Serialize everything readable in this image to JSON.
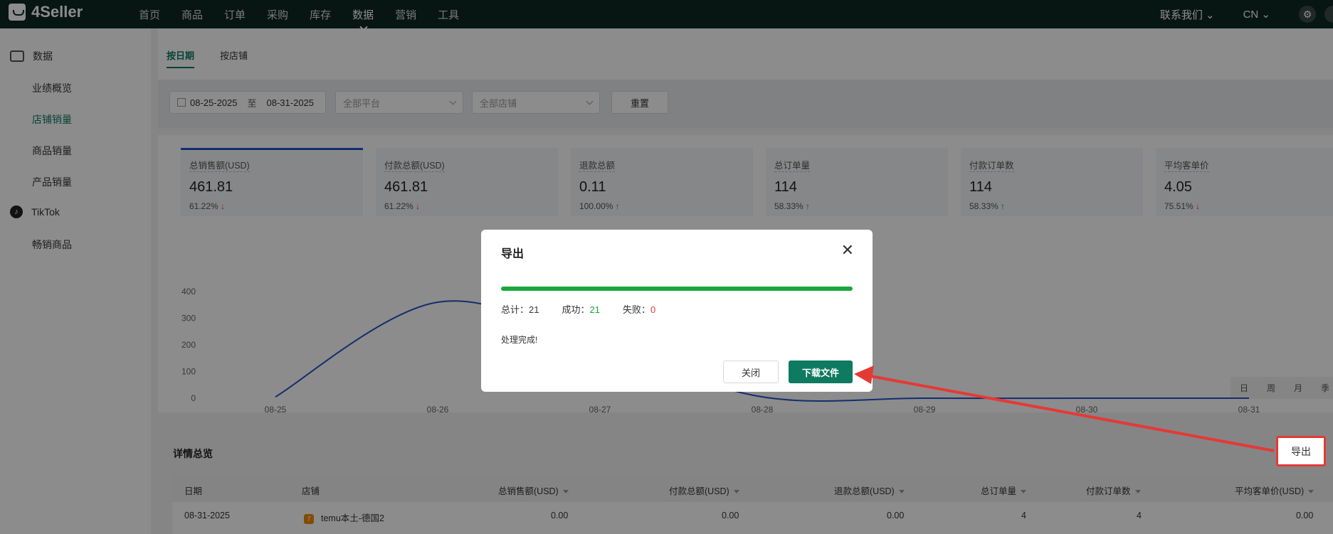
{
  "app": {
    "logo_text": "4Seller"
  },
  "nav": {
    "items": [
      "首页",
      "商品",
      "订单",
      "采购",
      "库存",
      "数据",
      "营销",
      "工具"
    ],
    "active": "数据"
  },
  "topbar": {
    "contact": "联系我们 ⌄",
    "lang": "CN ⌄"
  },
  "sidebar": {
    "group_data": "数据",
    "items": [
      "业绩概览",
      "店铺销量",
      "商品销量",
      "产品销量"
    ],
    "active": "店铺销量",
    "group_tiktok": "TikTok",
    "tiktok_items": [
      "畅销商品"
    ]
  },
  "tabs": [
    "按日期",
    "按店铺"
  ],
  "filters": {
    "date_from": "08-25-2025",
    "date_sep": "至",
    "date_to": "08-31-2025",
    "platform": "全部平台",
    "store": "全部店铺",
    "reset": "重置"
  },
  "kpis": [
    {
      "label": "总销售额(USD)",
      "value": "461.81",
      "change": "61.22%",
      "dir": "down"
    },
    {
      "label": "付款总额(USD)",
      "value": "461.81",
      "change": "61.22%",
      "dir": "down"
    },
    {
      "label": "退款总额",
      "value": "0.11",
      "change": "100.00%",
      "dir": "up"
    },
    {
      "label": "总订单量",
      "value": "114",
      "change": "58.33%",
      "dir": "up"
    },
    {
      "label": "付款订单数",
      "value": "114",
      "change": "58.33%",
      "dir": "up"
    },
    {
      "label": "平均客单价",
      "value": "4.05",
      "change": "75.51%",
      "dir": "down"
    }
  ],
  "period": [
    "日",
    "周",
    "月",
    "季"
  ],
  "chart_data": {
    "type": "line",
    "categories": [
      "08-25",
      "08-26",
      "08-27",
      "08-28",
      "08-29",
      "08-30",
      "08-31"
    ],
    "values": [
      5,
      360,
      195,
      5,
      0,
      0,
      0
    ],
    "yticks": [
      "0",
      "100",
      "200",
      "300",
      "400"
    ],
    "ylim": [
      0,
      400
    ],
    "color": "#2452c9"
  },
  "details": {
    "title": "详情总览",
    "export": "导出",
    "columns": [
      "日期",
      "店铺",
      "总销售额(USD)",
      "付款总额(USD)",
      "退款总额(USD)",
      "总订单量",
      "付款订单数",
      "平均客单价(USD)"
    ],
    "row": {
      "date": "08-31-2025",
      "store": "temu本土-德国2",
      "sales": "0.00",
      "paid": "0.00",
      "refund": "0.00",
      "orders": "4",
      "paid_orders": "4",
      "avg": "0.00"
    }
  },
  "modal": {
    "title": "导出",
    "progress": 1.0,
    "total_label": "总计：",
    "total": "21",
    "success_label": "成功：",
    "success": "21",
    "fail_label": "失败：",
    "fail": "0",
    "message": "处理完成!",
    "close": "关闭",
    "download": "下载文件"
  },
  "colors": {
    "brand": "#0e7a60",
    "progress": "#1aa73d",
    "annotation": "#e53935"
  }
}
